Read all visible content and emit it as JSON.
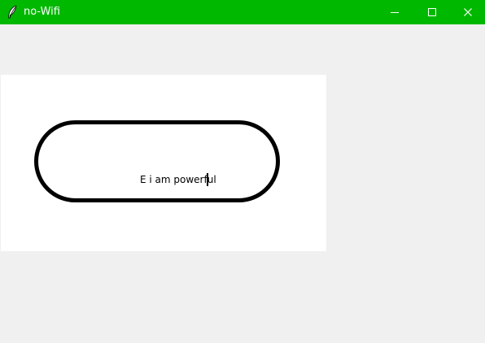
{
  "window": {
    "title": "no-Wifi",
    "title_bar_color": "#00b800",
    "controls": {
      "minimize_icon": "minimize-icon",
      "maximize_icon": "maximize-icon",
      "close_icon": "close-icon"
    }
  },
  "canvas": {
    "background": "#ffffff",
    "shape": "rounded-pill-outline",
    "text": "E i am powerful"
  }
}
